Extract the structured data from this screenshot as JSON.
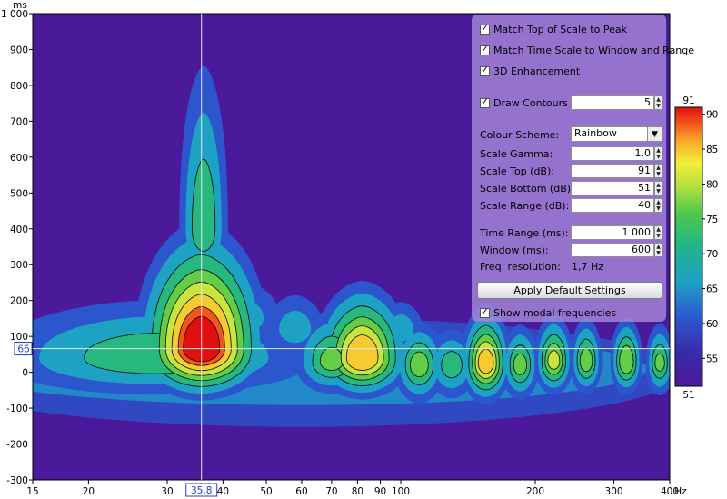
{
  "chart_data": {
    "type": "heatmap",
    "title": "",
    "x_unit": "Hz",
    "y_unit": "ms",
    "x_scale": "log",
    "xlim": [
      15,
      400
    ],
    "ylim": [
      -300,
      1000
    ],
    "x_tick_labels": [
      "15",
      "20",
      "30",
      "40",
      "50",
      "60",
      "70",
      "80",
      "90",
      "100",
      "200",
      "300",
      "400"
    ],
    "y_tick_labels": [
      "1 000",
      "900",
      "800",
      "700",
      "600",
      "500",
      "400",
      "300",
      "200",
      "100",
      "0",
      "-100",
      "-200",
      "-300"
    ],
    "cursor": {
      "x_label": "35,8",
      "y_label": "66"
    },
    "colorbar": {
      "top_label": "91",
      "bottom_label": "51",
      "ticks": [
        "90",
        "85",
        "80",
        "75",
        "70",
        "65",
        "60",
        "55"
      ]
    },
    "peaks": [
      {
        "freq_hz": 35.8,
        "time_ms": 66,
        "level_db": 91
      },
      {
        "freq_hz": 82,
        "time_ms": 40,
        "level_db": 84
      },
      {
        "freq_hz": 110,
        "time_ms": 20,
        "level_db": 72
      },
      {
        "freq_hz": 155,
        "time_ms": 25,
        "level_db": 80
      },
      {
        "freq_hz": 220,
        "time_ms": 30,
        "level_db": 74
      },
      {
        "freq_hz": 320,
        "time_ms": 30,
        "level_db": 72
      }
    ]
  },
  "panel": {
    "match_top": {
      "label": "Match Top of Scale to Peak",
      "checked": true
    },
    "match_time": {
      "label": "Match Time Scale to Window and Range",
      "checked": true
    },
    "enhance_3d": {
      "label": "3D Enhancement",
      "checked": true
    },
    "draw_contours": {
      "label": "Draw Contours",
      "checked": true,
      "value": "5"
    },
    "colour_scheme": {
      "label": "Colour Scheme:",
      "value": "Rainbow"
    },
    "scale_gamma": {
      "label": "Scale Gamma:",
      "value": "1,0"
    },
    "scale_top": {
      "label": "Scale Top (dB):",
      "value": "91"
    },
    "scale_bottom": {
      "label": "Scale Bottom (dB):",
      "value": "51"
    },
    "scale_range": {
      "label": "Scale Range (dB):",
      "value": "40"
    },
    "time_range": {
      "label": "Time Range (ms):",
      "value": "1 000"
    },
    "window": {
      "label": "Window (ms):",
      "value": "600"
    },
    "freq_resolution": {
      "label": "Freq. resolution:",
      "value": "1,7 Hz"
    },
    "apply_button": "Apply Default Settings",
    "show_modal": {
      "label": "Show modal frequencies",
      "checked": true
    }
  },
  "colors": {
    "background": "#4a1a9a",
    "panel": "#aa8cdc"
  },
  "icons": {
    "check": "check-icon",
    "spin_up": "spin-up-icon",
    "spin_down": "spin-down-icon",
    "dropdown": "dropdown-arrow-icon"
  }
}
